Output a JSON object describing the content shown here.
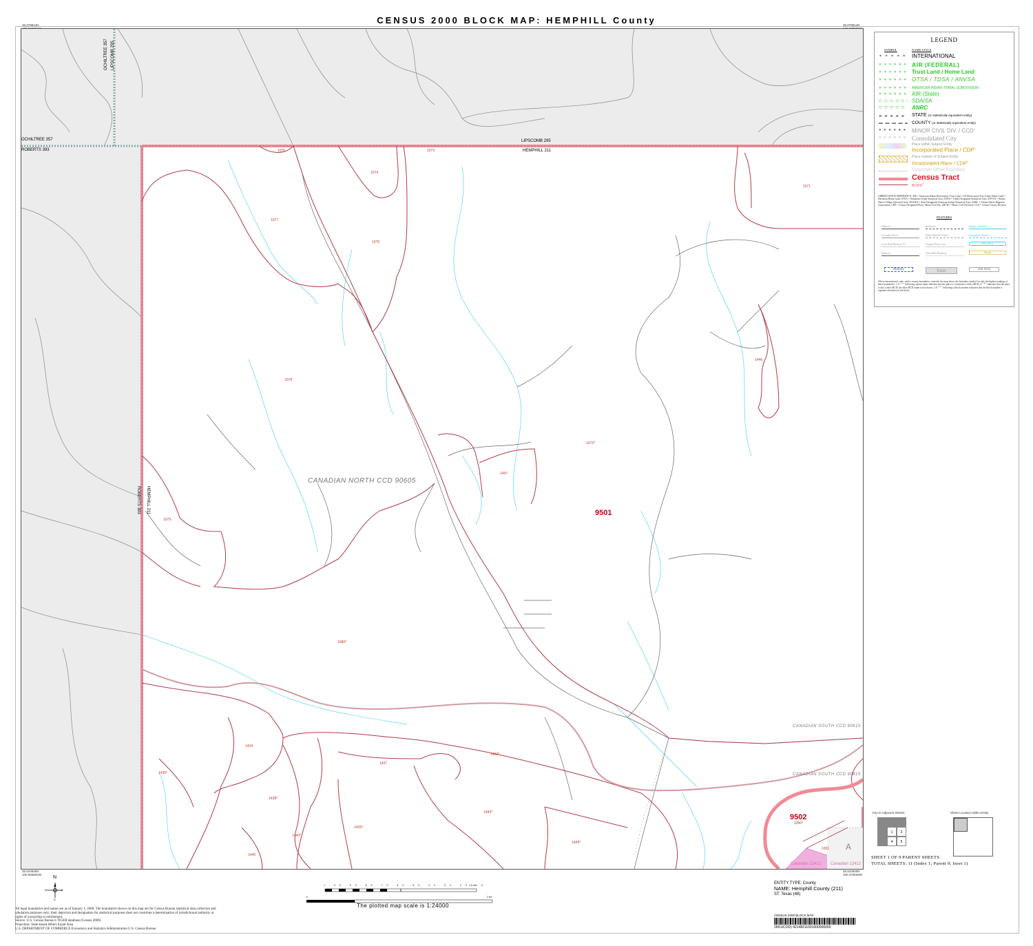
{
  "title": "CENSUS 2000 BLOCK MAP: HEMPHILL County",
  "colors": {
    "tract": "#f08a95",
    "block_line": "#b03a48",
    "stream": "#3ad0e8",
    "road": "#666666",
    "outside_area": "#ececec",
    "legend_green": "#22cc22",
    "legend_red": "#dd1122"
  },
  "corners": {
    "tl": [
      "36.079814N",
      "100.566904W"
    ],
    "tr": [
      "36.079814N",
      "100.370509W"
    ],
    "bl": [
      "35.910500N",
      "100.566904W"
    ],
    "br": [
      "35.910500N",
      "100.370509W"
    ]
  },
  "boundary_labels": {
    "ochiltree_357_v": "OCHILTREE 357",
    "lipscomb_295_v": "LIPSCOMB 295",
    "ochiltree_357_h": "OCHILTREE 357",
    "roberts_393_h": "ROBERTS 393",
    "lipscomb_295_h": "LIPSCOMB 295",
    "hemphill_211_h": "HEMPHILL 211",
    "hemphill_211_v": "HEMPHILL 211",
    "roberts_393_v": "ROBERTS 393"
  },
  "ccd_labels": {
    "north": "CANADIAN NORTH CCD 90605",
    "south1": "CANADIAN SOUTH CCD 90615",
    "south2": "CANADIAN SOUTH CCD 90615"
  },
  "tracts": [
    "9501",
    "9502"
  ],
  "blocks": [
    "1074",
    "1075",
    "1076",
    "1077",
    "1073",
    "1071",
    "1078",
    "1079",
    "1446",
    "1072*",
    "1447",
    "1080*",
    "1434",
    "1436*",
    "1437",
    "1432*",
    "1438*",
    "1439*",
    "1443*",
    "1444*",
    "1440*",
    "1445",
    "1090*",
    "1001"
  ],
  "place_labels": [
    "Canadian 12412",
    "Canadian 12412"
  ],
  "inset_letter": "A",
  "legend": {
    "title": "LEGEND",
    "symbol_header": "SYMBOL",
    "name_style_header": "NAME STYLE",
    "rows": [
      {
        "sym": "✦ ✦ ✦ ✦ ✦ ✦",
        "label": "INTERNATIONAL",
        "color": "#000000"
      },
      {
        "sym": "⋄ ⋄ ⋄ ⋄ ⋄ ⋄",
        "label": "AIR (FEDERAL)",
        "color": "#22cc22"
      },
      {
        "sym": "⋄ ⋄ ⋄ ⋄ ⋄ ⋄",
        "label": "Trust Land / Home Land",
        "color": "#22cc22"
      },
      {
        "sym": "⋄ ⋄ ⋄ ⋄ ⋄ ⋄",
        "label": "OTSA / TDSA / ANVSA",
        "color": "#22cc22"
      },
      {
        "sym": "⋄ ⋄ ⋄ ⋄ ⋄ ⋄",
        "label": "AMERICAN INDIAN TRIBAL SUBDIVISION",
        "color": "#22cc22"
      },
      {
        "sym": "⋄ ⋄ ⋄ ⋄ ⋄ ⋄",
        "label": "AIR (State)",
        "color": "#22cc22"
      },
      {
        "sym": "◇ ◇ ◇ ◇ ◇ ◇",
        "label": "SDAISA",
        "color": "#22cc22"
      },
      {
        "sym": "▽ ▽ ▽ ▽ ▽",
        "label": "ANRC",
        "color": "#22cc22"
      },
      {
        "sym": "▰ ▰ ▰ ▰ ▰",
        "label": "STATE",
        "suffix": "(or statistically equivalent entity)",
        "color": "#000000"
      },
      {
        "sym": "▬ ▬ ▬ ▬ ▬",
        "label": "COUNTY",
        "suffix": "(or statistically equivalent entity)",
        "color": "#000000"
      },
      {
        "sym": "● ● ● ● ● ●",
        "label": "MINOR CIVIL DIV. / CCD",
        "sup": "1",
        "color": "#999999"
      },
      {
        "sym": "○ ○ ○ ○ ○ ○",
        "label": "Consolidated City",
        "color": "#999999"
      },
      {
        "sym": "",
        "label": "Place within Subject Entity",
        "color": "#999999"
      },
      {
        "sym": "",
        "label": "Incorporated Place / CDP",
        "sup": "1",
        "color": "#cc9900"
      },
      {
        "sym": "",
        "label": "Place outside of Subject Entity",
        "color": "#999999"
      },
      {
        "sym": "",
        "label": "Incorporated Place / CDP",
        "sup": "1",
        "color": "#cc9900"
      },
      {
        "sym": "",
        "label": "Corporate Offset Boundary",
        "color": "#cccccc"
      },
      {
        "sym": "",
        "label": "Census Tract",
        "color": "#dd1122"
      },
      {
        "sym": "",
        "label": "BLOCK",
        "sup": "2",
        "color": "#dd1122"
      }
    ],
    "abbreviations": "ABBREVIATION REFERENCE: AIR = American Indian Reservation; Trust Land = Off-Reservation Trust Land; Home Land = Hawaiian Home Land; OTSA = Oklahoma Tribal Statistical Area; TDSA = Tribal Designated Statistical Area; ANVSA = Alaska Native Village Statistical Area; SDAISA = State Designated American Indian Statistical Area; ANRC = Alaska Native Regional Corporation; CDP = Census Designated Place; Minor Civil Div. (MCD) = Minor Civil Division; CCD = Census County Division",
    "features_title": "FEATURES",
    "features": [
      "Highway",
      "Rail Road",
      "Stream / Shoreline",
      "Secondary Road",
      "Ridge/Pipeline Feature",
      "Intermittent Stream",
      "Local Road/Railway Trl",
      "Property/Fence Line",
      "Water Body",
      "Railroad",
      "Nonvisible Boundary",
      "Glacier",
      "Military",
      "Inset",
      "Out Area"
    ],
    "notes": "Where international, state, and/or county boundaries coincide, the map shows the boundary symbol for only the highest-ranking of these boundaries. 1 A \" * \" following a place name indicates that the place is coextensive with a MCD. A \" * \" indicates that the place is also a false MCD; the false MCD name is not shown. 2 A \" * \" following a block number indicates that the block number is repeated elsewhere in the block."
  },
  "compass": {
    "n": "N",
    "s": "S",
    "e": "E",
    "w": "W"
  },
  "scale": {
    "ticks_top": [
      "1.0",
      "0.9",
      "0.8",
      "0.7",
      "0.6",
      "0.5",
      "0.4",
      "0.3",
      "0.2",
      "0.1",
      "0",
      "1.0 mi"
    ],
    "ticks_bottom": [
      "0",
      "2 km"
    ],
    "text": "The plotted map scale is 1:24000"
  },
  "footer": {
    "legal": "All legal boundaries and names are as of January 1, 2000. The boundaries shown on this map are for Census Bureau statistical data collection and tabulation purposes only; their depiction and designation for statistical purposes does not constitute a determination of jurisdictional authority or rights of ownership or entitlement.",
    "source": "Source: U.S. Census Bureau's TIGER database (Census 2000)",
    "projection": "Projection: State-based Albers Equal Area",
    "dept": "U.S. DEPARTMENT OF COMMERCE Economics and Statistics Administration U.S. Census Bureau"
  },
  "entity": {
    "type": "ENTITY TYPE: County",
    "name": "NAME: Hemphill County (211)",
    "st": "ST: Texas (48)"
  },
  "barcode": {
    "title": "CENSUS 2000 BLOCK MAP",
    "id": "2KKUCOD) 42148211001000000000"
  },
  "key": {
    "adjacent": "Key to Adjacent Sheets",
    "location": "Sheet Location within Entity",
    "cells": [
      "1",
      "2",
      "4",
      "5"
    ]
  },
  "sheet": {
    "line1": "SHEET 1 OF 9 PARENT SHEETS",
    "line2": "TOTAL SHEETS: 11 (Index 1; Parent 9; Inset 1)"
  }
}
